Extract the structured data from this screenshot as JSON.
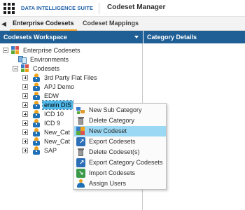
{
  "header": {
    "suite_name": "DATA INTELLIGENCE SUITE",
    "app_name": "Codeset Manager"
  },
  "tabs": [
    {
      "label": "Enterprise Codesets",
      "active": true
    },
    {
      "label": "Codeset Mappings",
      "active": false
    }
  ],
  "workspace": {
    "title": "Codesets Workspace",
    "tree": {
      "root": "Enterprise Codesets",
      "environments": "Environments",
      "codesets": "Codesets",
      "items": [
        "3rd Party Flat Files",
        "APJ Demo",
        "EDW",
        "erwin DIS",
        "ICD 10",
        "ICD 9",
        "New_Cat",
        "New_Cat",
        "SAP"
      ],
      "selected": "erwin DIS"
    }
  },
  "details": {
    "title": "Category Details"
  },
  "context_menu": {
    "items": [
      {
        "label": "New Sub Category",
        "icon": "new-sub-category-icon"
      },
      {
        "label": "Delete Category",
        "icon": "trash-icon"
      },
      {
        "label": "New Codeset",
        "icon": "new-codeset-icon",
        "highlighted": true
      },
      {
        "label": "Export Codesets",
        "icon": "export-icon"
      },
      {
        "label": "Delete Codeset(s)",
        "icon": "trash-icon"
      },
      {
        "label": "Export Category Codesets",
        "icon": "export-icon"
      },
      {
        "label": "Import Codesets",
        "icon": "import-icon"
      },
      {
        "label": "Assign Users",
        "icon": "users-icon"
      }
    ]
  },
  "colors": {
    "panel_header": "#1f5f95",
    "suite_brand": "#1d5fa8",
    "active_tab_underline": "#f0a023",
    "selection": "#4fb7e8",
    "menu_highlight": "#9bd8f4"
  }
}
